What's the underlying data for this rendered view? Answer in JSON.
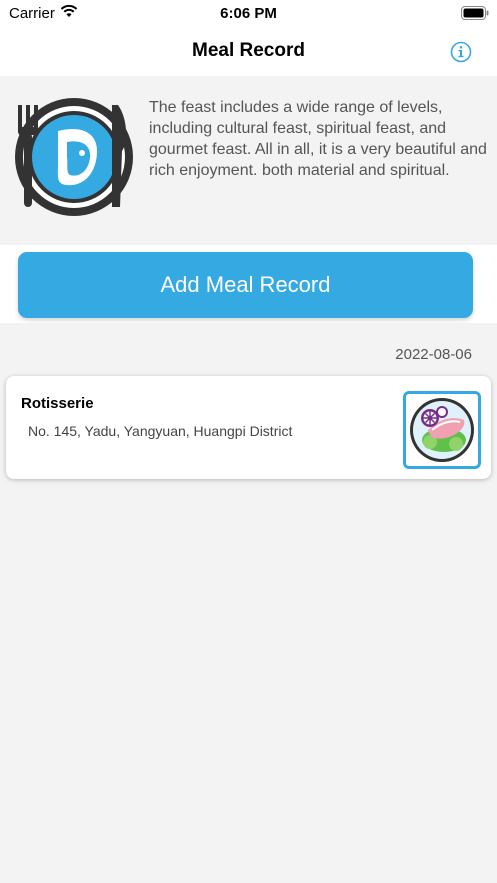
{
  "status_bar": {
    "carrier": "Carrier",
    "time": "6:06 PM"
  },
  "nav": {
    "title": "Meal Record",
    "info_icon": "info-icon"
  },
  "hero": {
    "icon": "plate-icon",
    "text": "The feast includes a wide range of levels, including cultural feast, spiritual feast, and gourmet feast. All in all, it is a very beautiful and rich enjoyment. both material and spiritual."
  },
  "add_button": {
    "label": "Add Meal Record"
  },
  "records": [
    {
      "date": "2022-08-06",
      "name": "Rotisserie",
      "address": "No. 145, Yadu, Yangyuan, Huangpi District",
      "thumbnail": "dish-icon"
    }
  ],
  "colors": {
    "accent": "#35a9e2",
    "dark": "#333333",
    "background": "#f3f3f3"
  }
}
